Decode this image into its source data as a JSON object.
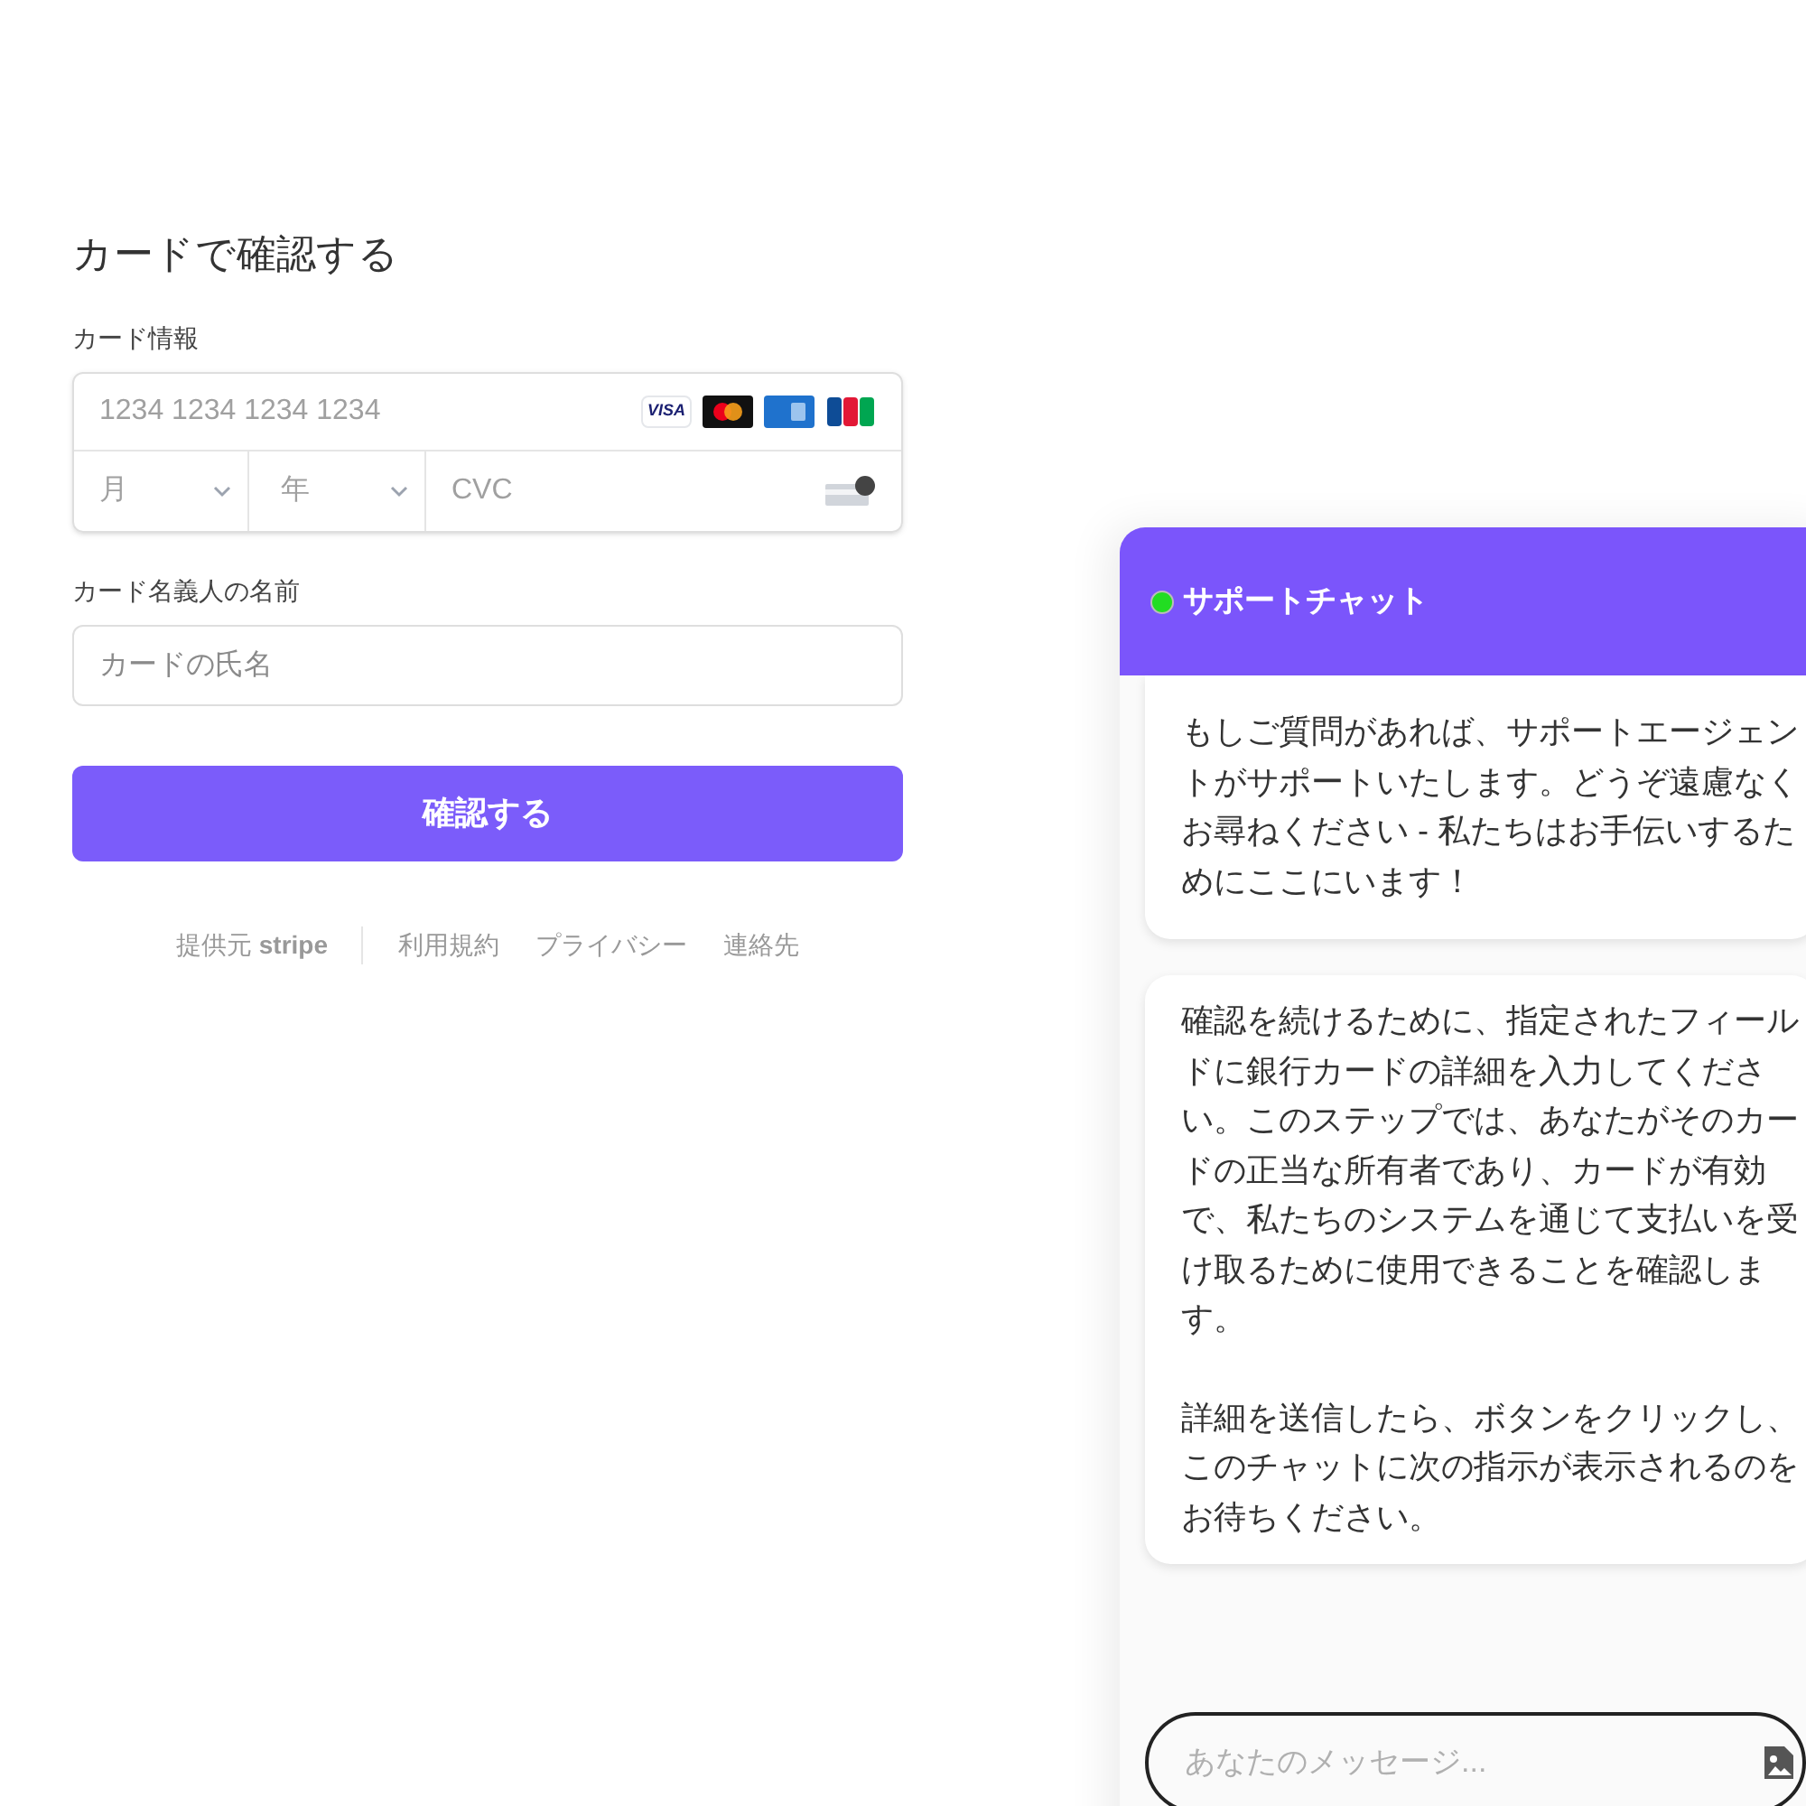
{
  "form": {
    "title": "カードで確認する",
    "card_label": "カード情報",
    "card_number_placeholder": "1234 1234 1234 1234",
    "brands": [
      {
        "kind": "visa",
        "text": "VISA"
      },
      {
        "kind": "mastercard"
      },
      {
        "kind": "amex"
      },
      {
        "kind": "jcb"
      }
    ],
    "month_placeholder": "月",
    "year_placeholder": "年",
    "cvc_placeholder": "CVC",
    "name_label": "カード名義人の名前",
    "name_placeholder": "カードの氏名",
    "submit": "確認する"
  },
  "footer": {
    "powered_by": "提供元 **stripe**",
    "links": [
      "利用規約",
      "プライバシー",
      "連絡先"
    ]
  },
  "chat": {
    "title": "サポートチャット",
    "online": true,
    "messages": [
      [
        "もしご質問があれば、サポートエージェントがサポートいたします。どうぞ遠慮なくお尋ねください - 私たちはお手伝いするためにここにいます！"
      ],
      [
        "確認を続けるために、指定されたフィールドに銀行カードの詳細を入力してください。このステップでは、あなたがそのカードの正当な所有者であり、カードが有効で、私たちのシステムを通じて支払いを受け取るために使用できることを確認します。",
        "詳細を送信したら、ボタンをクリックし、このチャットに次の指示が表示されるのをお待ちください。"
      ]
    ],
    "input_placeholder": "あなたのメッセージ..."
  }
}
